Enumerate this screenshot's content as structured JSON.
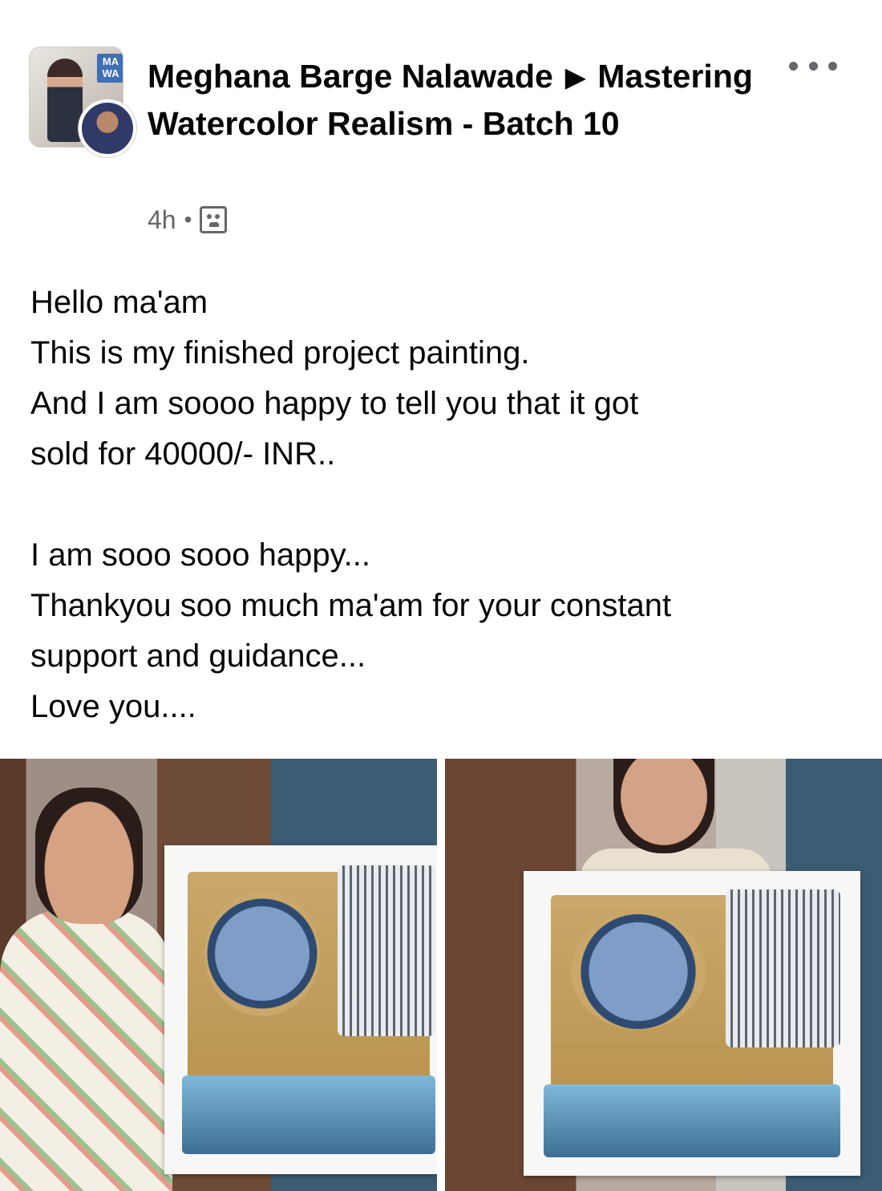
{
  "post": {
    "author": "Meghana Barge Nalawade",
    "arrow": "▶",
    "group": "Mastering Watercolor Realism - Batch 10",
    "timestamp": "4h",
    "separator": "•",
    "avatar_badge": "MA\nWA",
    "privacy_icon": "group-members-icon",
    "more_icon": "more-options-icon",
    "body": "Hello ma'am\nThis is my finished project painting.\nAnd I am soooo happy to tell you that it got\nsold for 40000/- INR..\n\nI am sooo sooo happy...\nThankyou soo much  ma'am for your constant\nsupport and guidance...\nLove you...."
  },
  "photos": [
    {
      "subject": "woman-holding-painting-left"
    },
    {
      "subject": "woman-holding-painting-right"
    }
  ]
}
